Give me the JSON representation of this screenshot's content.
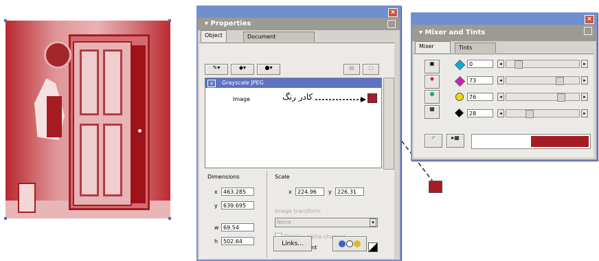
{
  "properties": {
    "title": "Properties",
    "tabs": [
      "Object",
      "Document"
    ],
    "object_name": "Grayscale JPEG",
    "image_label": "Image",
    "annotation": "کادر رنگ",
    "dimensions_label": "Dimensions",
    "scale_label": "Scale",
    "x_label": "x",
    "y_label": "y",
    "w_label": "w",
    "h_label": "h",
    "x_value": "463.285",
    "y_value": "639.695",
    "w_value": "69.54",
    "h_value": "502.64",
    "scale_x_value": "224.96",
    "scale_y_value": "226.31",
    "image_transform_label": "Image transform",
    "image_transform_value": "None",
    "checkbox1_label": "Display alpha channel",
    "transparent_label": "Transparent",
    "links_button": "Links..."
  },
  "mixer": {
    "title": "Mixer and Tints",
    "tabs": [
      "Mixer",
      "Tints"
    ],
    "channels": [
      {
        "color": "#00aadd",
        "value": "0"
      },
      {
        "color": "#cc22aa",
        "value": "73"
      },
      {
        "color": "#eedd00",
        "value": "76"
      },
      {
        "color": "#000000",
        "value": "28"
      }
    ],
    "swatch_color": "#a61c24"
  },
  "colors": {
    "accent_red": "#a61c24",
    "titlebar": "#6f8fcf"
  }
}
